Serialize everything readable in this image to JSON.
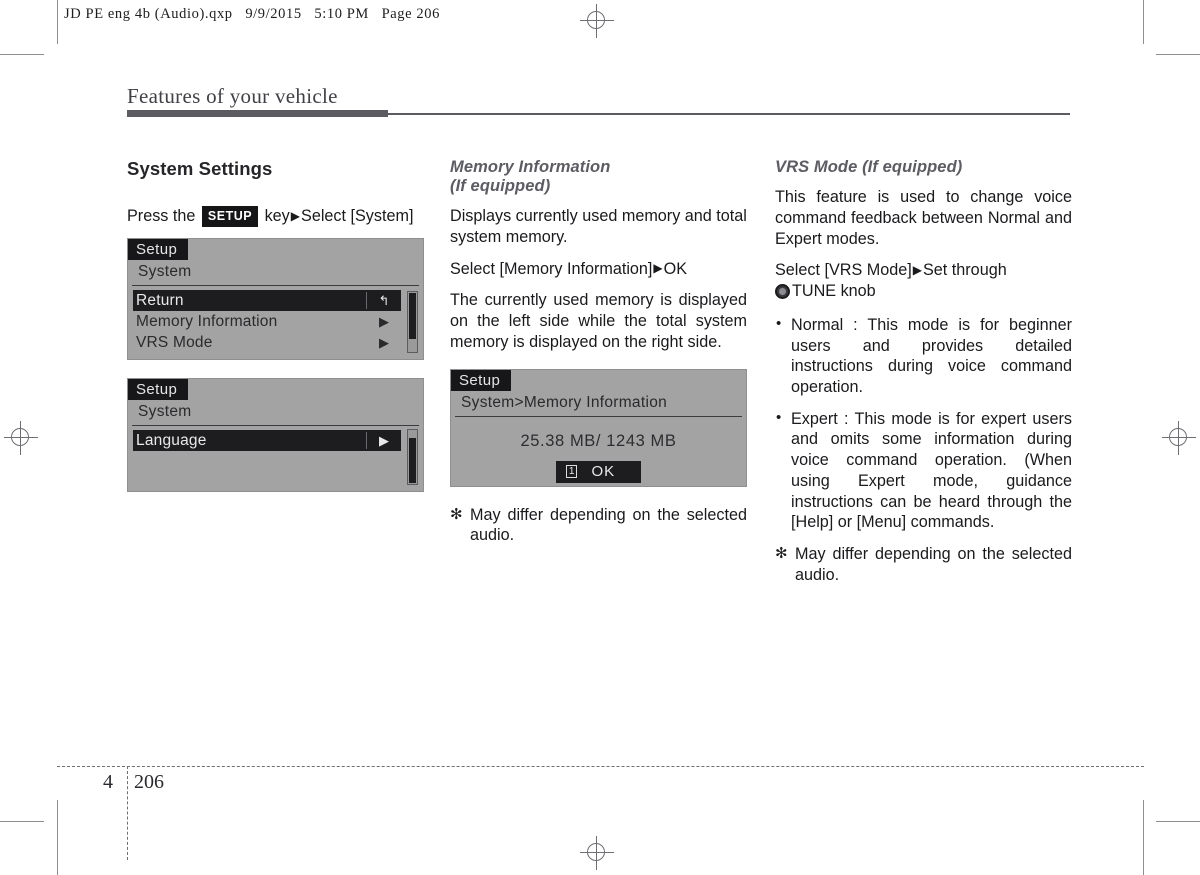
{
  "print_marks": {
    "file_header": "JD PE eng 4b (Audio).qxp   9/9/2015   5:10 PM   Page 206"
  },
  "header": {
    "chapter_title": "Features of your vehicle"
  },
  "footer": {
    "chapter_number": "4",
    "page_number": "206"
  },
  "left_column": {
    "heading": "System Settings",
    "instruction": {
      "prefix": "Press the",
      "key_badge": "SETUP",
      "middle": "key",
      "arrow": "▶",
      "suffix": "Select [System]"
    },
    "screen1": {
      "title": "Setup",
      "subtitle": "System",
      "rows": [
        {
          "label": "Return",
          "icon": "↰",
          "icon_name": "return-arrow-icon",
          "selected": true
        },
        {
          "label": "Memory Information",
          "icon": "▶",
          "icon_name": "chevron-right-icon",
          "selected": false
        },
        {
          "label": "VRS Mode",
          "icon": "▶",
          "icon_name": "chevron-right-icon",
          "selected": false
        }
      ]
    },
    "screen2": {
      "title": "Setup",
      "subtitle": "System",
      "rows": [
        {
          "label": "Language",
          "icon": "▶",
          "icon_name": "chevron-right-icon",
          "selected": true
        }
      ]
    }
  },
  "middle_column": {
    "heading_line1": "Memory Information",
    "heading_line2": "(If equipped)",
    "paragraph1": "Displays currently used memory and total system memory.",
    "select_line": {
      "prefix": "Select [Memory Information]",
      "arrow": "▶",
      "suffix": "OK"
    },
    "paragraph2": "The currently used memory is displayed on the left side while the total system memory is displayed on the right side.",
    "screen3": {
      "title": "Setup",
      "subtitle": "System>Memory Information",
      "memory_value": "25.38 MB/ 1243 MB",
      "ok_badge_number": "1",
      "ok_label": "OK"
    },
    "note": {
      "symbol": "✻",
      "text": "May differ depending on the selected audio."
    }
  },
  "right_column": {
    "heading": "VRS Mode (If equipped)",
    "paragraph1": "This feature is used to change voice command feedback between Normal and Expert modes.",
    "select_line": {
      "prefix": "Select  [VRS  Mode]",
      "arrow": "▶",
      "middle": "Set  through",
      "knob_icon_name": "tune-knob-icon",
      "suffix": "TUNE knob"
    },
    "bullets": [
      "Normal : This mode is for beginner users and provides detailed instructions during voice command operation.",
      "Expert : This mode is for expert users and omits some information during voice command operation. (When using Expert mode, guidance instructions can be heard through the [Help] or [Menu] commands."
    ],
    "note": {
      "symbol": "✻",
      "text": "May differ depending on the selected audio."
    }
  },
  "colors": {
    "lcd_background": "#a3a3a3",
    "lcd_selected": "#1d1d20",
    "title_bar": "#5b5b61",
    "heading_gray": "#5c5c62"
  }
}
